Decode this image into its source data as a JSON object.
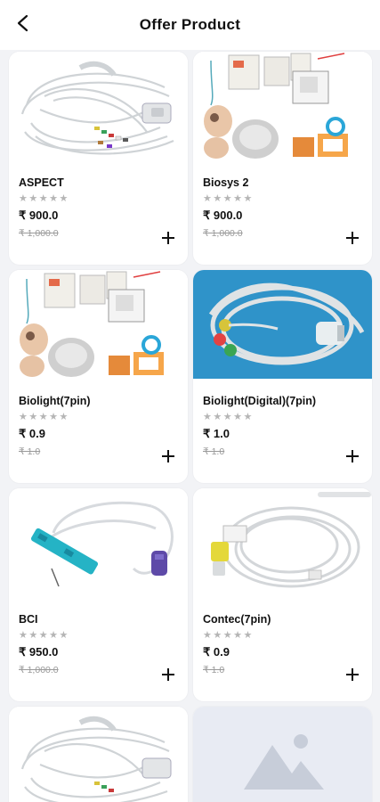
{
  "header": {
    "title": "Offer Product"
  },
  "icons": {
    "back": "back-arrow-icon",
    "add": "plus-icon",
    "rating": "star-icon",
    "placeholder": "image-placeholder-icon"
  },
  "products": [
    {
      "name": "ASPECT",
      "stars": "★★★★★",
      "price": "₹ 900.0",
      "mrp": "₹ 1,000.0",
      "image": "ecg-cable"
    },
    {
      "name": "Biosys 2",
      "stars": "★★★★★",
      "price": "₹ 900.0",
      "mrp": "₹ 1,000.0",
      "image": "defib-pads"
    },
    {
      "name": "Biolight(7pin)",
      "stars": "★★★★★",
      "price": "₹ 0.9",
      "mrp": "₹ 1.0",
      "image": "defib-pads"
    },
    {
      "name": "Biolight(Digital)(7pin)",
      "stars": "★★★★★",
      "price": "₹ 1.0",
      "mrp": "₹ 1.0",
      "image": "trunk-cable-blue"
    },
    {
      "name": "BCI",
      "stars": "★★★★★",
      "price": "₹ 950.0",
      "mrp": "₹ 1,000.0",
      "image": "spo2-sensor"
    },
    {
      "name": "Contec(7pin)",
      "stars": "★★★★★",
      "price": "₹ 0.9",
      "mrp": "₹ 1.0",
      "image": "coiled-cable"
    },
    {
      "image": "ecg-cable"
    },
    {
      "image": "placeholder"
    }
  ],
  "colors": {
    "background": "#f2f3f6",
    "card": "#ffffff",
    "muted": "#9a9a9a",
    "star": "#b5b5b5",
    "placeholder": "#e8ebf3"
  }
}
